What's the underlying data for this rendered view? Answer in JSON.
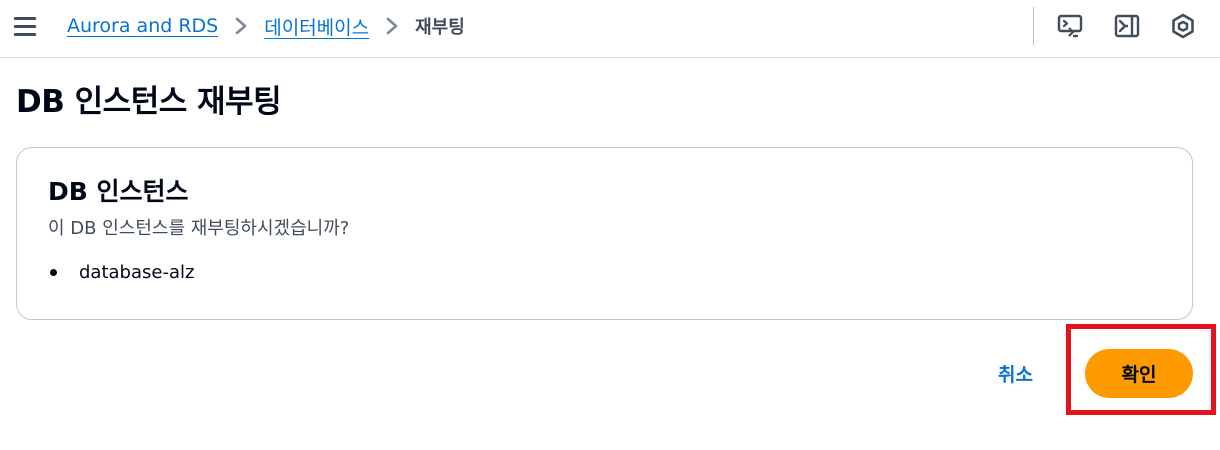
{
  "breadcrumb": {
    "items": [
      {
        "label": "Aurora and RDS"
      },
      {
        "label": "데이터베이스"
      }
    ],
    "current": "재부팅"
  },
  "toolbar": {
    "icons": [
      "cloudshell-icon",
      "side-panel-icon",
      "settings-hex-icon"
    ]
  },
  "page": {
    "title": "DB 인스턴스 재부팅"
  },
  "card": {
    "title": "DB 인스턴스",
    "description": "이 DB 인스턴스를 재부팅하시겠습니까?",
    "items": [
      "database-alz"
    ]
  },
  "actions": {
    "cancel_label": "취소",
    "confirm_label": "확인"
  },
  "colors": {
    "link": "#0972d3",
    "primary_button": "#ff9900",
    "highlight_border": "#e3121f"
  }
}
